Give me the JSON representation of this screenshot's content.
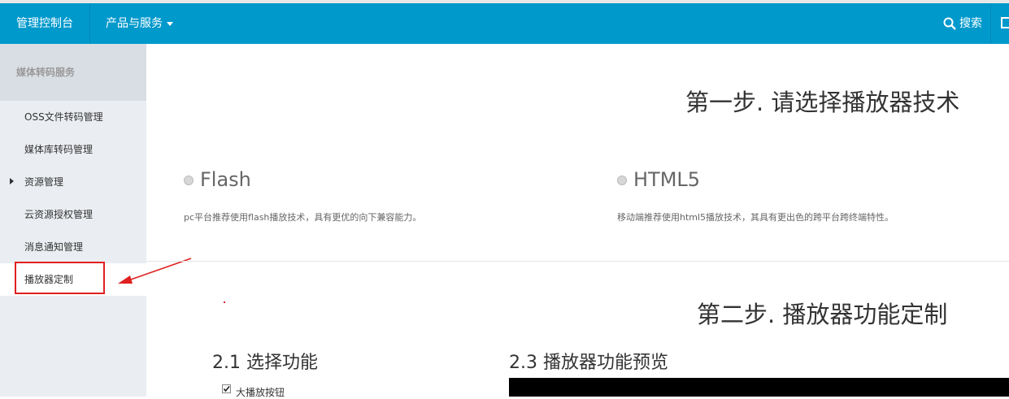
{
  "topbar": {
    "brand": "管理控制台",
    "products": "产品与服务",
    "search": "搜索"
  },
  "sidebar": {
    "title": "媒体转码服务",
    "items": [
      {
        "label": "OSS文件转码管理"
      },
      {
        "label": "媒体库转码管理"
      },
      {
        "label": "资源管理"
      },
      {
        "label": "云资源授权管理"
      },
      {
        "label": "消息通知管理"
      },
      {
        "label": "播放器定制"
      }
    ]
  },
  "step1": {
    "title": "第一步. 请选择播放器技术",
    "options": [
      {
        "label": "Flash",
        "desc": "pc平台推荐使用flash播放技术，具有更优的向下兼容能力。"
      },
      {
        "label": "HTML5",
        "desc": "移动端推荐使用html5播放技术，其具有更出色的跨平台跨终端特性。"
      }
    ]
  },
  "step2": {
    "title": "第二步. 播放器功能定制",
    "select_title": "2.1 选择功能",
    "preview_title": "2.3 播放器功能预览",
    "features": [
      {
        "label": "大播放按钮",
        "checked": true
      }
    ]
  },
  "colors": {
    "topbar": "#0099cc",
    "sidebar": "#eaedf1",
    "annotation": "#e02020"
  }
}
